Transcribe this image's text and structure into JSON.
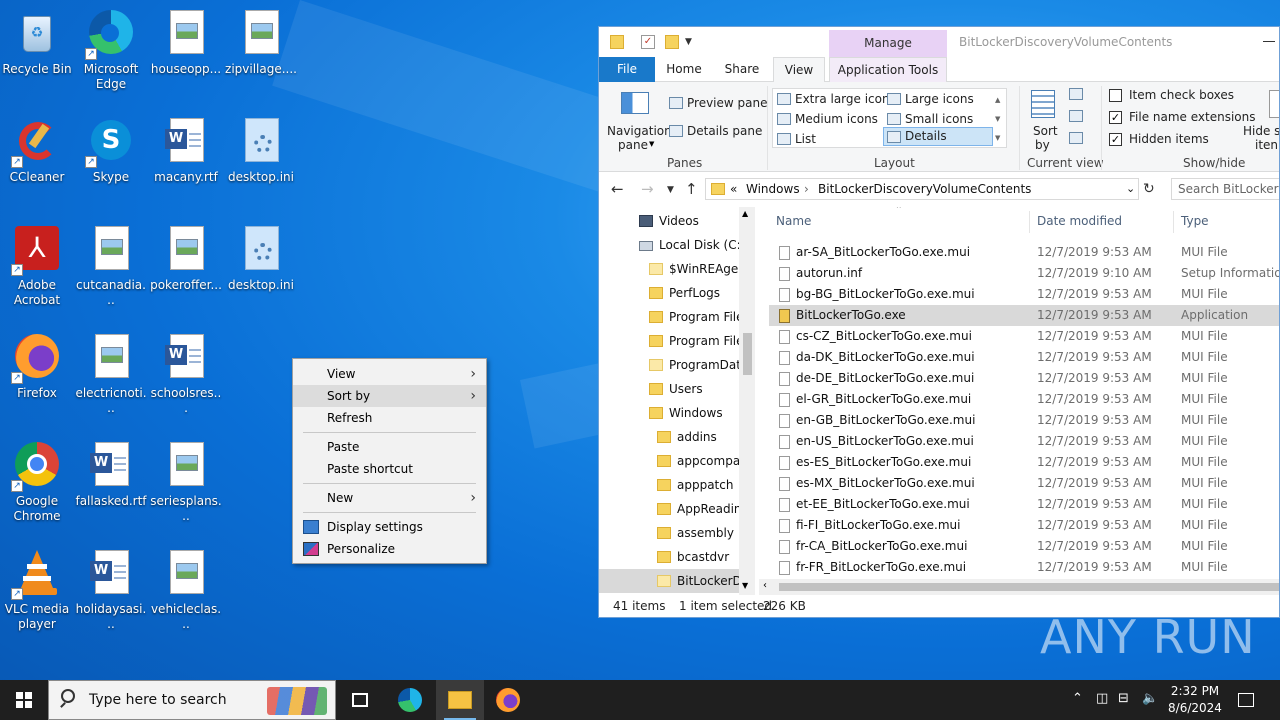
{
  "desktop": {
    "icons": [
      {
        "label": "Recycle Bin",
        "icon": "recycle-bin-icon"
      },
      {
        "label": "Microsoft Edge",
        "icon": "edge-icon"
      },
      {
        "label": "houseopp...",
        "icon": "image-file-icon"
      },
      {
        "label": "zipvillage....",
        "icon": "image-file-icon"
      },
      {
        "label": "CCleaner",
        "icon": "ccleaner-icon"
      },
      {
        "label": "Skype",
        "icon": "skype-icon"
      },
      {
        "label": "macany.rtf",
        "icon": "word-doc-icon"
      },
      {
        "label": "desktop.ini",
        "icon": "settings-file-icon"
      },
      {
        "label": "Adobe Acrobat",
        "icon": "acrobat-icon"
      },
      {
        "label": "cutcanadia...",
        "icon": "image-file-icon"
      },
      {
        "label": "pokeroffer...",
        "icon": "image-file-icon"
      },
      {
        "label": "desktop.ini",
        "icon": "settings-file-icon"
      },
      {
        "label": "Firefox",
        "icon": "firefox-icon"
      },
      {
        "label": "electricnoti...",
        "icon": "image-file-icon"
      },
      {
        "label": "schoolsres...",
        "icon": "word-doc-icon"
      },
      {
        "label": "Google Chrome",
        "icon": "chrome-icon"
      },
      {
        "label": "fallasked.rtf",
        "icon": "word-doc-icon"
      },
      {
        "label": "seriesplans...",
        "icon": "image-file-icon"
      },
      {
        "label": "VLC media player",
        "icon": "vlc-icon"
      },
      {
        "label": "holidaysasi...",
        "icon": "word-doc-icon"
      },
      {
        "label": "vehicleclas...",
        "icon": "image-file-icon"
      }
    ]
  },
  "context_menu": {
    "items": [
      {
        "label": "View",
        "submenu": true
      },
      {
        "label": "Sort by",
        "submenu": true,
        "highlighted": true
      },
      {
        "label": "Refresh"
      },
      {
        "label": "Paste"
      },
      {
        "label": "Paste shortcut"
      },
      {
        "label": "New",
        "submenu": true
      },
      {
        "label": "Display settings",
        "icon": "display-icon"
      },
      {
        "label": "Personalize",
        "icon": "personalize-icon"
      }
    ]
  },
  "explorer": {
    "title": "BitLockerDiscoveryVolumeContents",
    "manage_tab": "Manage",
    "tabs": {
      "file": "File",
      "home": "Home",
      "share": "Share",
      "view": "View",
      "app_tools": "Application Tools"
    },
    "ribbon": {
      "navigation_pane": "Navigation",
      "navigation_pane2": "pane",
      "preview_pane": "Preview pane",
      "details_pane": "Details pane",
      "panes_group": "Panes",
      "layout": {
        "extra_large": "Extra large icons",
        "large": "Large icons",
        "medium": "Medium icons",
        "small": "Small icons",
        "list": "List",
        "details": "Details"
      },
      "layout_group": "Layout",
      "sort_by": "Sort",
      "sort_by2": "by",
      "current_view_group": "Current view",
      "item_check_boxes": "Item check boxes",
      "file_name_extensions": "File name extensions",
      "hidden_items": "Hidden items",
      "show_hide_group": "Show/hide",
      "hide_selected": "Hide se",
      "hide_selected2": "iten"
    },
    "address": {
      "prefix": "«",
      "crumb1": "Windows",
      "crumb2": "BitLockerDiscoveryVolumeContents",
      "search_placeholder": "Search BitLockerDis"
    },
    "nav_pane": [
      {
        "label": "Videos",
        "level": 1,
        "type": "videos"
      },
      {
        "label": "Local Disk (C:)",
        "level": 1,
        "type": "drive"
      },
      {
        "label": "$WinREAgent",
        "level": 2,
        "type": "folder-light"
      },
      {
        "label": "PerfLogs",
        "level": 2,
        "type": "folder"
      },
      {
        "label": "Program Files",
        "level": 2,
        "type": "folder"
      },
      {
        "label": "Program Files",
        "level": 2,
        "type": "folder"
      },
      {
        "label": "ProgramData",
        "level": 2,
        "type": "folder-light"
      },
      {
        "label": "Users",
        "level": 2,
        "type": "folder"
      },
      {
        "label": "Windows",
        "level": 2,
        "type": "folder"
      },
      {
        "label": "addins",
        "level": 3,
        "type": "folder"
      },
      {
        "label": "appcompat",
        "level": 3,
        "type": "folder"
      },
      {
        "label": "apppatch",
        "level": 3,
        "type": "folder"
      },
      {
        "label": "AppReadiness",
        "level": 3,
        "type": "folder"
      },
      {
        "label": "assembly",
        "level": 3,
        "type": "folder"
      },
      {
        "label": "bcastdvr",
        "level": 3,
        "type": "folder"
      },
      {
        "label": "BitLockerDiscoveryVolumeContents",
        "level": 3,
        "type": "folder-light",
        "selected": true
      }
    ],
    "columns": {
      "name": "Name",
      "date": "Date modified",
      "type": "Type"
    },
    "files": [
      {
        "name": "ar-SA_BitLockerToGo.exe.mui",
        "date": "12/7/2019 9:53 AM",
        "type": "MUI File"
      },
      {
        "name": "autorun.inf",
        "date": "12/7/2019 9:10 AM",
        "type": "Setup Information"
      },
      {
        "name": "bg-BG_BitLockerToGo.exe.mui",
        "date": "12/7/2019 9:53 AM",
        "type": "MUI File"
      },
      {
        "name": "BitLockerToGo.exe",
        "date": "12/7/2019 9:53 AM",
        "type": "Application",
        "selected": true
      },
      {
        "name": "cs-CZ_BitLockerToGo.exe.mui",
        "date": "12/7/2019 9:53 AM",
        "type": "MUI File"
      },
      {
        "name": "da-DK_BitLockerToGo.exe.mui",
        "date": "12/7/2019 9:53 AM",
        "type": "MUI File"
      },
      {
        "name": "de-DE_BitLockerToGo.exe.mui",
        "date": "12/7/2019 9:53 AM",
        "type": "MUI File"
      },
      {
        "name": "el-GR_BitLockerToGo.exe.mui",
        "date": "12/7/2019 9:53 AM",
        "type": "MUI File"
      },
      {
        "name": "en-GB_BitLockerToGo.exe.mui",
        "date": "12/7/2019 9:53 AM",
        "type": "MUI File"
      },
      {
        "name": "en-US_BitLockerToGo.exe.mui",
        "date": "12/7/2019 9:53 AM",
        "type": "MUI File"
      },
      {
        "name": "es-ES_BitLockerToGo.exe.mui",
        "date": "12/7/2019 9:53 AM",
        "type": "MUI File"
      },
      {
        "name": "es-MX_BitLockerToGo.exe.mui",
        "date": "12/7/2019 9:53 AM",
        "type": "MUI File"
      },
      {
        "name": "et-EE_BitLockerToGo.exe.mui",
        "date": "12/7/2019 9:53 AM",
        "type": "MUI File"
      },
      {
        "name": "fi-FI_BitLockerToGo.exe.mui",
        "date": "12/7/2019 9:53 AM",
        "type": "MUI File"
      },
      {
        "name": "fr-CA_BitLockerToGo.exe.mui",
        "date": "12/7/2019 9:53 AM",
        "type": "MUI File"
      },
      {
        "name": "fr-FR_BitLockerToGo.exe.mui",
        "date": "12/7/2019 9:53 AM",
        "type": "MUI File"
      }
    ],
    "status": {
      "items": "41 items",
      "selected": "1 item selected",
      "size": "226 KB"
    }
  },
  "watermark": "ANY RUN",
  "taskbar": {
    "search_placeholder": "Type here to search",
    "time": "2:32 PM",
    "date": "8/6/2024",
    "pinned": [
      "task-view-icon",
      "edge-icon",
      "file-explorer-icon",
      "firefox-icon"
    ]
  },
  "colors": {
    "accent": "#1979ca",
    "manage_tab": "#e8d2f5",
    "selection": "#cce4f7",
    "wallpaper": "#0a6fd6"
  }
}
